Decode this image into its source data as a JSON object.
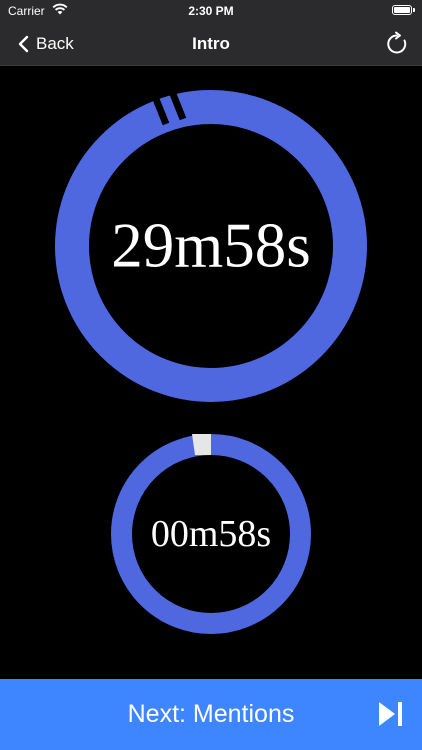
{
  "status_bar": {
    "carrier": "Carrier",
    "time": "2:30 PM"
  },
  "nav": {
    "back_label": "Back",
    "title": "Intro",
    "reset_icon": "refresh-icon"
  },
  "timers": {
    "total": {
      "label": "29m58s",
      "elapsed_fraction": 0.0011,
      "color": "#4f68e0"
    },
    "segment": {
      "label": "00m58s",
      "elapsed_fraction": 0.033,
      "color": "#4f68e0",
      "marker_color": "#e6e6e6"
    }
  },
  "footer": {
    "next_label": "Next: Mentions",
    "skip_icon": "skip-forward-icon",
    "color": "#3d86ff"
  }
}
